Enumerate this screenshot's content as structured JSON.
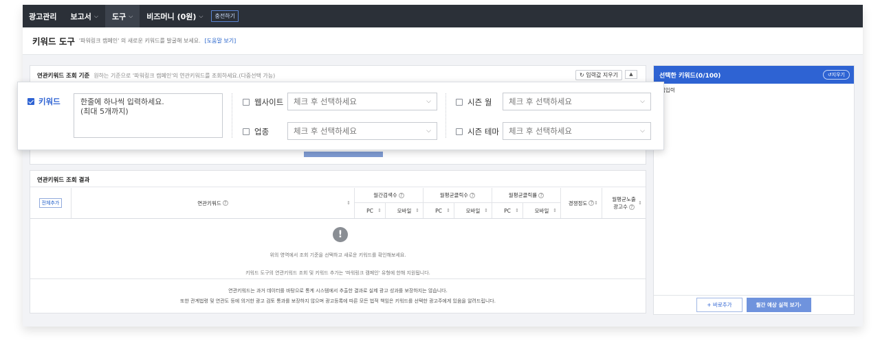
{
  "nav": {
    "items": [
      {
        "label": "광고관리",
        "has_caret": false
      },
      {
        "label": "보고서",
        "has_caret": true
      },
      {
        "label": "도구",
        "has_caret": true,
        "active": true
      },
      {
        "label": "비즈머니 (0원)",
        "has_caret": true
      }
    ],
    "charge_label": "충전하기",
    "caret": "⌵"
  },
  "title": {
    "main": "키워드 도구",
    "sub": "'파워링크 캠페인' 의 새로운 키워드를 발굴해 보세요.",
    "help": "[도움말 보기]"
  },
  "criteria": {
    "heading": "연관키워드 조회 기준",
    "desc": "원하는 기준으로 '파워링크 캠페인'의 연관키워드를 조회하세요.(다중선택 가능)",
    "reset_label": "입력값 지우기",
    "collapse_icon": "up-arrow-icon"
  },
  "overlay": {
    "keyword_label": "키워드",
    "keyword_checked": true,
    "keyword_placeholder_line1": "한줄에 하나씩 입력하세요.",
    "keyword_placeholder_line2": "(최대 5개까지)",
    "website_label": "웹사이트",
    "website_select": "체크 후 선택하세요",
    "industry_label": "업종",
    "industry_select": "체크 후 선택하세요",
    "season_month_label": "시즌 월",
    "season_month_select": "체크 후 선택하세요",
    "season_theme_label": "시즌 테마",
    "season_theme_select": "체크 후 선택하세요",
    "chevron": "⌵"
  },
  "results": {
    "title": "연관키워드 조회 결과",
    "add_all": "전체추가",
    "col_keyword": "연관키워드",
    "col_monthly_search": "월간검색수",
    "col_avg_clicks": "월평균클릭수",
    "col_avg_ctr": "월평균클릭률",
    "col_competition": "경쟁정도",
    "col_avg_ads_line1": "월평균노출",
    "col_avg_ads_line2": "광고수",
    "sub_pc": "PC",
    "sub_mobile": "모바일",
    "hint": "?",
    "sort": "⇕",
    "empty_icon": "!",
    "empty_msg1": "위의 영역에서 조회 기준을 선택하고 새로운 키워드를 확인해보세요.",
    "empty_msg2": "키워드 도구의 연관키워드 조회 및 키워드 추가는 '파워링크 캠페인' 유형에 한해 지원됩니다.",
    "note1": "연관키워드는 과거 데이터를 바탕으로 통계 시스템에서 추출한 결과로 실제 광고 성과를 보장하지는 않습니다.",
    "note2": "또한 관계법령 및 연관도 등에 의거한 광고 검토 통과를 보장하지 않으며 광고등록에 따른 모든 법적 책임은 키워드를 선택한 광고주에게 있음을 알려드립니다."
  },
  "selected": {
    "title": "선택한 키워드(0/100)",
    "reset": "↺지우기",
    "input_hint": "접입력",
    "add_btn": "+ 바로추가",
    "monthly_btn": "월간 예상 실적 보기›"
  },
  "colors": {
    "nav_bg": "#2b3038",
    "accent": "#2e63d3",
    "page_bg": "#f2f3f6"
  }
}
